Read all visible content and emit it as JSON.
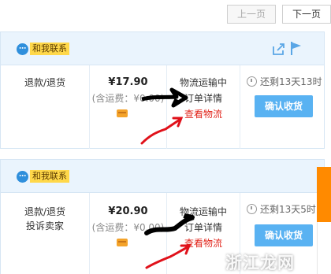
{
  "pager": {
    "prev_label": "上一页",
    "next_label": "下一页"
  },
  "orders": [
    {
      "contact_label": "和我联系",
      "actions": [
        "退款/退货"
      ],
      "price": "¥17.90",
      "price_note": "(含运费：¥0.00)",
      "status": "物流运输中",
      "detail_link": "订单详情",
      "logistics_link": "查看物流",
      "time_left": "还剩13天13时",
      "confirm_label": "确认收货"
    },
    {
      "contact_label": "和我联系",
      "actions": [
        "退款/退货",
        "投诉卖家"
      ],
      "price": "¥20.90",
      "price_note": "(含运费：¥0.00)",
      "status": "物流运输中",
      "detail_link": "订单详情",
      "logistics_link": "查看物流",
      "time_left": "还剩13天5时",
      "confirm_label": "确认收货"
    }
  ],
  "watermark": "浙江龙网",
  "icons": {
    "bubble": "chat-bubble-icon",
    "share": "share-icon",
    "flag": "flag-icon",
    "pay": "payment-card-icon",
    "clock": "clock-icon"
  }
}
